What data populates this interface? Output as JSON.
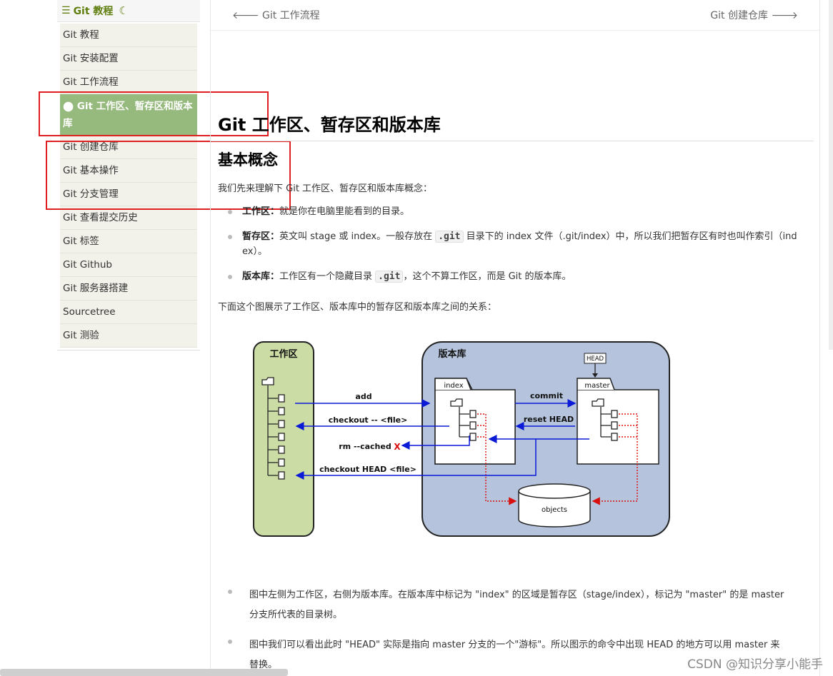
{
  "sidebar": {
    "title": "Git 教程",
    "items": [
      {
        "label": "Git 教程"
      },
      {
        "label": "Git 安装配置"
      },
      {
        "label": "Git 工作流程"
      },
      {
        "label": "Git 工作区、暂存区和版本库"
      },
      {
        "label": "Git 创建仓库"
      },
      {
        "label": "Git 基本操作"
      },
      {
        "label": "Git 分支管理"
      },
      {
        "label": "Git 查看提交历史"
      },
      {
        "label": "Git 标签"
      },
      {
        "label": "Git Github"
      },
      {
        "label": "Git 服务器搭建"
      },
      {
        "label": "Sourcetree"
      },
      {
        "label": "Git 测验"
      }
    ]
  },
  "nav": {
    "prev": "Git 工作流程",
    "next": "Git 创建仓库"
  },
  "article": {
    "title": "Git 工作区、暂存区和版本库",
    "section": "基本概念",
    "intro": "我们先来理解下 Git 工作区、暂存区和版本库概念：",
    "bullets": [
      {
        "term": "工作区：",
        "text": "就是你在电脑里能看到的目录。"
      },
      {
        "term": "暂存区：",
        "text_a": "英文叫 stage 或 index。一般存放在 ",
        "code": ".git",
        "text_b": " 目录下的 index 文件（.git/index）中，所以我们把暂存区有时也叫作索引（ind",
        "text_c": "ex）。"
      },
      {
        "term": "版本库：",
        "text_a": "工作区有一个隐藏目录 ",
        "code": ".git",
        "text_b": "，这个不算工作区，而是 Git 的版本库。"
      }
    ],
    "diagram_intro": "下面这个图展示了工作区、版本库中的暂存区和版本库之间的关系：",
    "notes": [
      {
        "line1": "图中左侧为工作区，右侧为版本库。在版本库中标记为 \"index\" 的区域是暂存区（stage/index），标记为 \"master\" 的是 master",
        "line2": "分支所代表的目录树。"
      },
      {
        "line1": "图中我们可以看出此时 \"HEAD\" 实际是指向 master 分支的一个\"游标\"。所以图示的命令中出现 HEAD 的地方可以用 master 来",
        "line2": "替换。"
      }
    ]
  },
  "diagram": {
    "workspace": "工作区",
    "repo": "版本库",
    "index": "index",
    "master": "master",
    "head": "HEAD",
    "objects": "objects",
    "cmd_add": "add",
    "cmd_checkout_file": "checkout -- <file>",
    "cmd_rm": "rm --cached",
    "cmd_x": "X",
    "cmd_checkout_head": "checkout HEAD <file>",
    "cmd_commit": "commit",
    "cmd_reset": "reset HEAD"
  },
  "watermark": "CSDN @知识分享小能手"
}
